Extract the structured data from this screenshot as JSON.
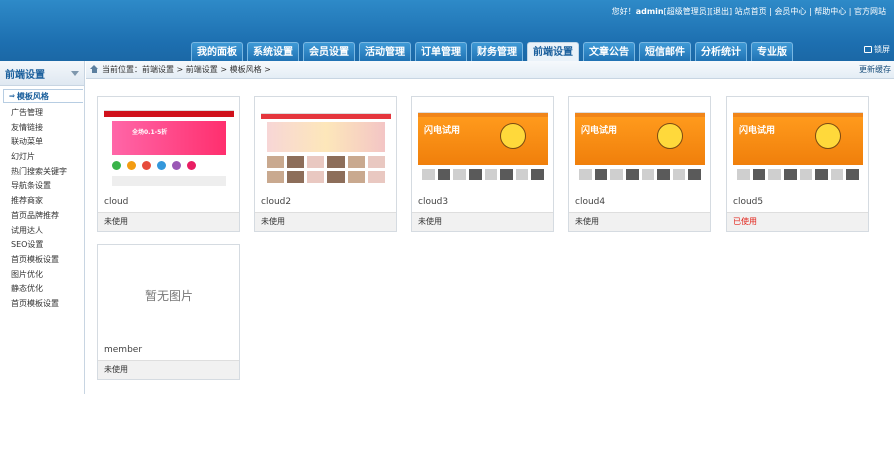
{
  "header": {
    "greeting": "您好！",
    "username": "admin",
    "role": "[超级管理员]",
    "logout": "[退出]",
    "links": [
      "站点首页",
      "会员中心",
      "帮助中心",
      "官方网站"
    ],
    "lock_label": "锁屏"
  },
  "nav": {
    "tabs": [
      "我的面板",
      "系统设置",
      "会员设置",
      "活动管理",
      "订单管理",
      "财务管理",
      "前端设置",
      "文章公告",
      "短信邮件",
      "分析统计",
      "专业版"
    ],
    "active": "前端设置"
  },
  "sidebar": {
    "title": "前端设置",
    "current": "模板风格",
    "items": [
      "广告管理",
      "友情链接",
      "联动菜单",
      "幻灯片",
      "热门搜索关键字",
      "导航条设置",
      "推荐商家",
      "首页品牌推荐",
      "试用达人",
      "SEO设置",
      "首页模板设置",
      "图片优化",
      "静态优化",
      "首页模板设置"
    ]
  },
  "breadcrumb": {
    "label": "当前位置：",
    "path": "前端设置 > 前端设置 > 模板风格 >",
    "refresh": "更新缓存"
  },
  "templates": [
    {
      "name": "cloud",
      "status": "未使用",
      "in_use": false,
      "thumb": "a"
    },
    {
      "name": "cloud2",
      "status": "未使用",
      "in_use": false,
      "thumb": "b"
    },
    {
      "name": "cloud3",
      "status": "未使用",
      "in_use": false,
      "thumb": "c"
    },
    {
      "name": "cloud4",
      "status": "未使用",
      "in_use": false,
      "thumb": "c"
    },
    {
      "name": "cloud5",
      "status": "已使用",
      "in_use": true,
      "thumb": "c"
    },
    {
      "name": "member",
      "status": "未使用",
      "in_use": false,
      "thumb": "none",
      "no_image_text": "暂无图片"
    }
  ],
  "thumb_texts": {
    "a_banner": "全场0.1-5折",
    "c_banner": "闪电试用"
  },
  "colors": {
    "header_blue": "#1d6fb0",
    "used_red": "#e2231a",
    "link_blue": "#1a5f9c"
  }
}
